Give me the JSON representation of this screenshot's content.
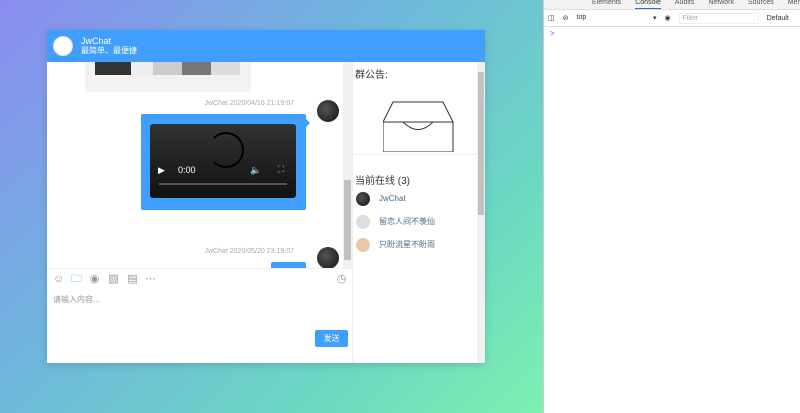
{
  "header": {
    "title": "JwChat",
    "subtitle": "最简单、最便捷"
  },
  "messages": [
    {
      "meta": "JwChat 2020/04/16 21:19:07",
      "video_time": "0:00"
    },
    {
      "meta": "JwChat 2020/05/20 23:19:07"
    }
  ],
  "side": {
    "notice_title": "群公告:",
    "online_title": "当前在线 (3)",
    "users": [
      "JwChat",
      "留恋人间不羡仙",
      "只盼流星不盼雨"
    ]
  },
  "input": {
    "placeholder": "请输入内容...",
    "send_label": "发送"
  },
  "devtools": {
    "tabs": [
      "Elements",
      "Console",
      "Audits",
      "Network",
      "Sources",
      "Mem"
    ],
    "context": "top",
    "filter_placeholder": "Filter",
    "levels": "Default",
    "prompt": ">"
  },
  "colors": {
    "accent": "#409eff"
  }
}
